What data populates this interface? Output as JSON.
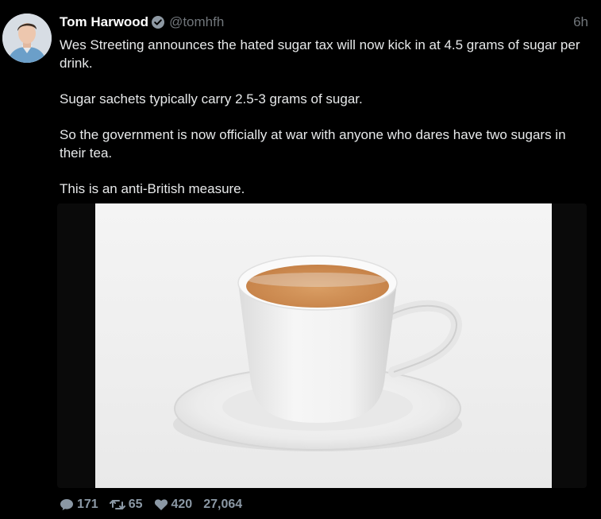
{
  "author": {
    "name": "Tom Harwood",
    "handle": "@tomhfh",
    "verified": true,
    "avatar_icon": "avatar-portrait"
  },
  "timestamp": "6h",
  "paragraphs": [
    "Wes Streeting announces the hated sugar tax will now kick in at 4.5 grams of sugar per drink.",
    "Sugar sachets typically carry 2.5-3 grams of sugar.",
    "So the government is now officially at war with anyone who dares have two sugars in their tea.",
    "This is an anti-British measure."
  ],
  "media": {
    "subject": "cup of tea on saucer"
  },
  "actions": {
    "replies": "171",
    "retweets": "65",
    "likes": "420",
    "views": "27,064"
  },
  "colors": {
    "background": "#000000",
    "text": "#e7e9ea",
    "muted": "#71767b",
    "tea": "#d4915a"
  }
}
